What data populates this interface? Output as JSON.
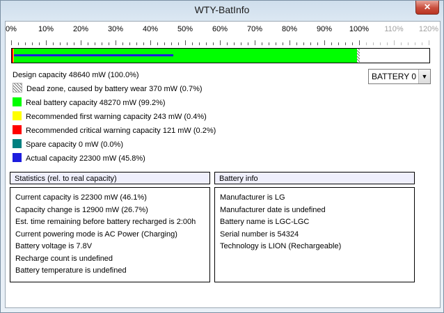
{
  "window": {
    "title": "WTY-BatInfo",
    "close_glyph": "✕"
  },
  "scale": {
    "labels": [
      "0%",
      "10%",
      "20%",
      "30%",
      "40%",
      "50%",
      "60%",
      "70%",
      "80%",
      "90%",
      "100%",
      "110%",
      "120%"
    ]
  },
  "bar": {
    "real_capacity_fraction": 0.992,
    "dead_zone_fraction": 0.007,
    "first_warning_fraction": 0.004,
    "critical_warning_fraction": 0.002,
    "actual_capacity_fraction": 0.458
  },
  "legend": {
    "design": "Design capacity 48640 mW (100.0%)",
    "dead_zone": "Dead zone, caused by battery wear 370 mW (0.7%)",
    "real": "Real battery capacity 48270 mW (99.2%)",
    "first_warning": "Recommended first warning capacity 243 mW (0.4%)",
    "critical_warning": "Recommended critical warning capacity 121 mW (0.2%)",
    "spare": "Spare capacity  0 mW (0.0%)",
    "actual": "Actual capacity 22300 mW (45.8%)"
  },
  "colors": {
    "real": "#00ff00",
    "first_warning": "#ffff00",
    "critical_warning": "#ff0000",
    "spare": "#008080",
    "actual": "#1d1dde"
  },
  "battery_select": {
    "value": "BATTERY 0"
  },
  "statistics": {
    "title": "Statistics (rel. to real capacity)",
    "lines": [
      "Current capacity is 22300 mW (46.1%)",
      "Capacity change is 12900 mW (26.7%)",
      "Est. time remaining before battery recharged is 2:00h",
      "Current powering mode is AC Power (Charging)",
      "Battery voltage is 7.8V",
      "Recharge count is undefined",
      "Battery temperature is undefined"
    ]
  },
  "battery_info": {
    "title": "Battery info",
    "lines": [
      "Manufacturer is  LG",
      "Manufacturer date is undefined",
      "Battery name is LGC-LGC",
      "Serial number is 54324",
      "Technology is LION (Rechargeable)"
    ]
  }
}
